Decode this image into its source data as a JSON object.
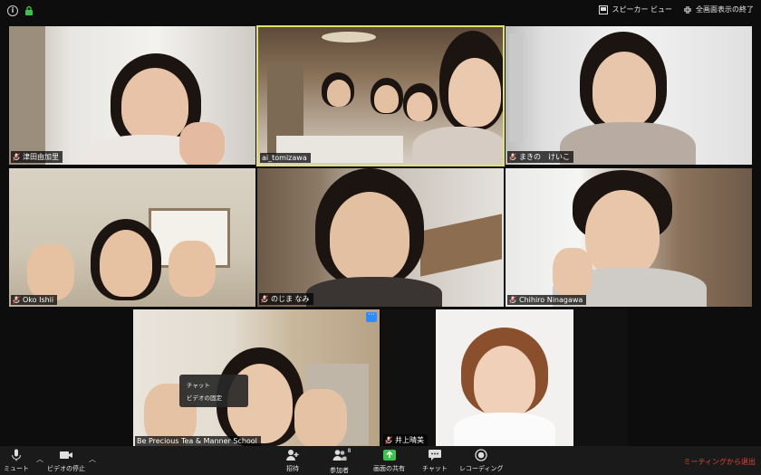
{
  "top_bar": {
    "speaker_view_label": "スピーカー ビュー",
    "exit_fullscreen_label": "全画面表示の終了"
  },
  "participants": [
    {
      "name": "津田由加里",
      "muted": true
    },
    {
      "name": "ai_tomizawa",
      "muted": false,
      "active_speaker": true
    },
    {
      "name": "まきの　けいこ",
      "muted": true
    },
    {
      "name": "Oko  Ishii",
      "muted": true
    },
    {
      "name": "のじま なみ",
      "muted": true
    },
    {
      "name": "Chihiro Ninagawa",
      "muted": true
    },
    {
      "name": "Be Precious Tea & Manner School",
      "muted": false
    },
    {
      "name": "井上晴美",
      "muted": true
    }
  ],
  "context_menu": {
    "items": [
      "チャット",
      "ビデオの固定"
    ]
  },
  "more_button_label": "···",
  "toolbar": {
    "mute_label": "ミュート",
    "video_label": "ビデオの停止",
    "invite_label": "招待",
    "participants_label": "参加者",
    "participants_count": "8",
    "share_label": "画面の共有",
    "chat_label": "チャット",
    "record_label": "レコーディング",
    "end_label": "ミーティングから退出"
  },
  "colors": {
    "active_border": "#e1e36d",
    "accent_blue": "#2d8cff",
    "share_green": "#3ec34a",
    "end_red": "#e0473a"
  }
}
